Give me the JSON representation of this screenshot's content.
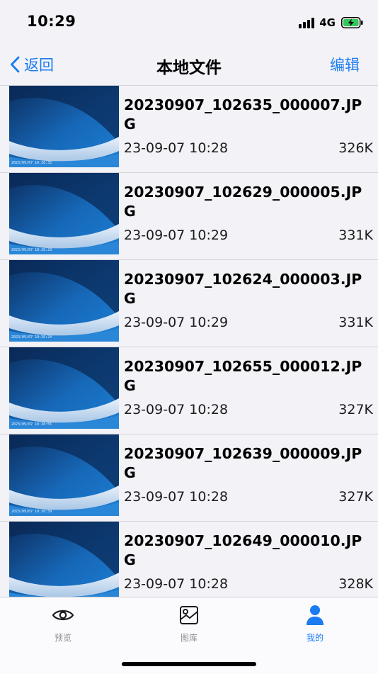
{
  "status_bar": {
    "time": "10:29",
    "network": "4G"
  },
  "nav": {
    "back_label": "返回",
    "title": "本地文件",
    "edit_label": "编辑"
  },
  "files": [
    {
      "name": "20230907_102635_000007.JPG",
      "date": "23-09-07 10:28",
      "size": "326K",
      "stamp": "2023/09/07 10:26:35"
    },
    {
      "name": "20230907_102629_000005.JPG",
      "date": "23-09-07 10:29",
      "size": "331K",
      "stamp": "2023/09/07 10:26:29"
    },
    {
      "name": "20230907_102624_000003.JPG",
      "date": "23-09-07 10:29",
      "size": "331K",
      "stamp": "2023/09/07 10:26:24"
    },
    {
      "name": "20230907_102655_000012.JPG",
      "date": "23-09-07 10:28",
      "size": "327K",
      "stamp": "2023/09/07 10:26:55"
    },
    {
      "name": "20230907_102639_000009.JPG",
      "date": "23-09-07 10:28",
      "size": "327K",
      "stamp": "2023/09/07 10:26:39"
    },
    {
      "name": "20230907_102649_000010.JPG",
      "date": "23-09-07 10:28",
      "size": "328K",
      "stamp": "2023/09/07 10:26:49"
    }
  ],
  "tabs": [
    {
      "label": "预览",
      "icon": "eye-icon",
      "active": false
    },
    {
      "label": "图库",
      "icon": "gallery-icon",
      "active": false
    },
    {
      "label": "我的",
      "icon": "person-icon",
      "active": true
    }
  ],
  "colors": {
    "accent": "#1a7bf2",
    "inactive": "#8e8e93",
    "background": "#f2f2f7",
    "battery_fill": "#34c759"
  }
}
